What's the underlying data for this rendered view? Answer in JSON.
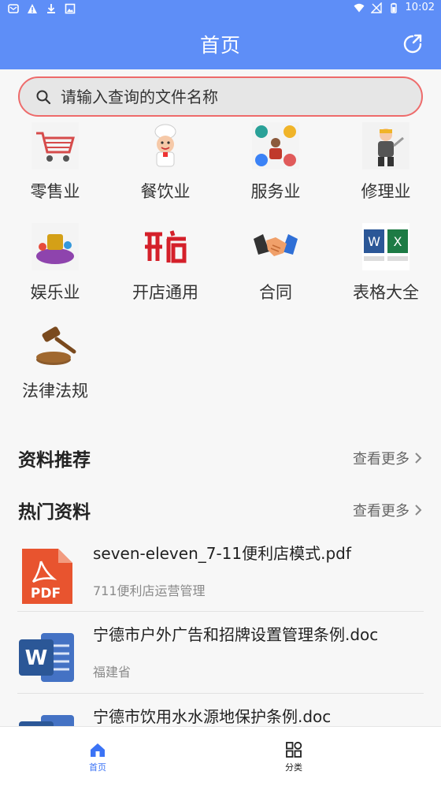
{
  "status_bar": {
    "time": "10:02",
    "left_icons": [
      "message-icon",
      "warning-icon",
      "download-icon",
      "image-icon"
    ],
    "right_icons": [
      "wifi-icon",
      "no-signal-icon",
      "battery-icon"
    ]
  },
  "header": {
    "title": "首页",
    "action_icon": "refresh-icon"
  },
  "search": {
    "placeholder": "请输入查询的文件名称"
  },
  "categories": [
    {
      "label": "零售业",
      "icon": "shopping-cart-icon"
    },
    {
      "label": "餐饮业",
      "icon": "chef-icon"
    },
    {
      "label": "服务业",
      "icon": "service-icon"
    },
    {
      "label": "修理业",
      "icon": "repair-icon"
    },
    {
      "label": "娱乐业",
      "icon": "entertainment-icon"
    },
    {
      "label": "开店通用",
      "icon": "open-store-icon"
    },
    {
      "label": "合同",
      "icon": "handshake-icon"
    },
    {
      "label": "表格大全",
      "icon": "office-docs-icon"
    },
    {
      "label": "法律法规",
      "icon": "gavel-icon"
    }
  ],
  "sections": {
    "recommend": {
      "title": "资料推荐",
      "more": "查看更多"
    },
    "hot": {
      "title": "热门资料",
      "more": "查看更多"
    }
  },
  "documents": [
    {
      "title": "seven-eleven_7-11便利店模式.pdf",
      "subtitle": "711便利店运营管理",
      "type": "pdf",
      "icon_text": "PDF"
    },
    {
      "title": "宁德市户外广告和招牌设置管理条例.doc",
      "subtitle": "福建省",
      "type": "word",
      "icon_text": "W"
    },
    {
      "title": "宁德市饮用水水源地保护条例.doc",
      "subtitle": "",
      "type": "word",
      "icon_text": "W"
    }
  ],
  "bottom_nav": [
    {
      "label": "首页",
      "icon": "home-icon",
      "active": true
    },
    {
      "label": "分类",
      "icon": "category-icon",
      "active": false
    }
  ],
  "colors": {
    "primary": "#5e8ef7",
    "search_border": "#ee6b6b",
    "pdf": "#e8542f",
    "word": "#2b5797"
  }
}
